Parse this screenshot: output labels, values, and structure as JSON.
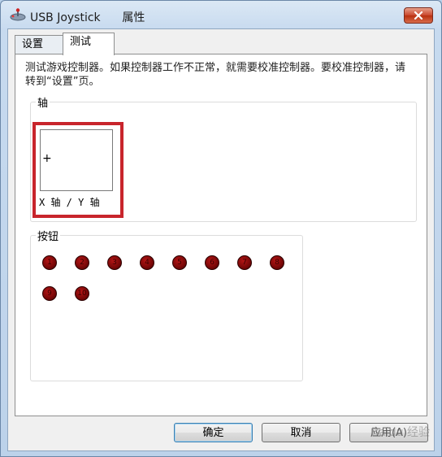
{
  "window": {
    "title": "USB Joystick      属性",
    "accent": "#c8252c"
  },
  "tabs": [
    {
      "label": "设置"
    },
    {
      "label": "测试"
    }
  ],
  "test": {
    "description": "测试游戏控制器。如果控制器工作不正常，就需要校准控制器。要校准控制器，请转到“设置”页。",
    "axes": {
      "label": "轴",
      "crosshair": "+",
      "caption": "X 轴 / Y 轴"
    },
    "buttons": {
      "label": "按钮",
      "items": [
        "1",
        "2",
        "3",
        "4",
        "5",
        "6",
        "7",
        "8",
        "9",
        "10"
      ]
    }
  },
  "footer": {
    "ok": "确定",
    "cancel": "取消",
    "apply": "应用(A)"
  },
  "watermark": "Baidu 经验"
}
